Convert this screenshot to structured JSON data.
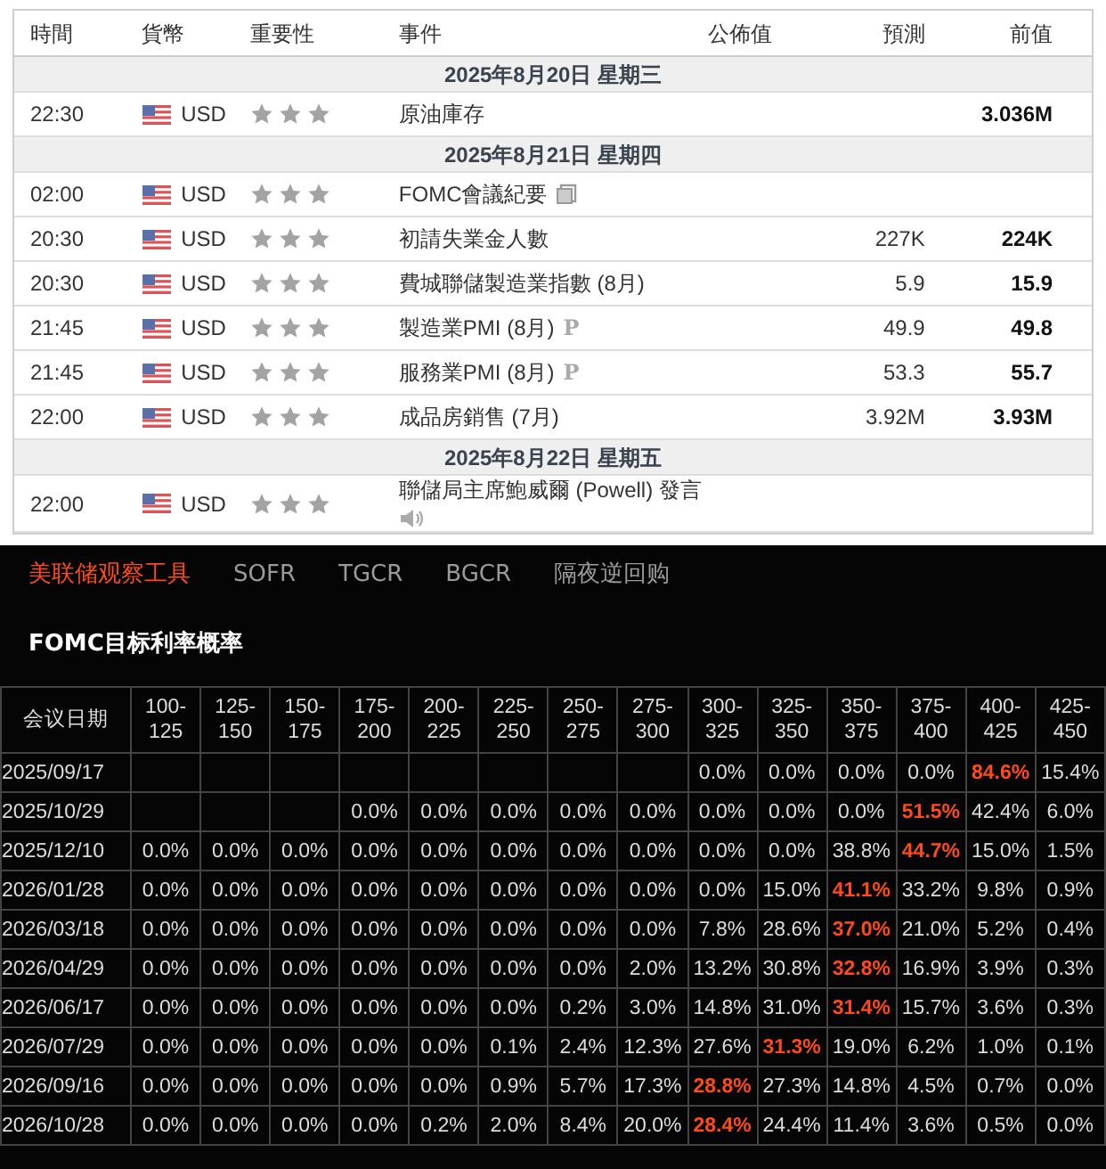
{
  "calendar": {
    "columns": [
      "時間",
      "貨幣",
      "重要性",
      "事件",
      "公佈值",
      "預測",
      "前值"
    ],
    "rows": [
      {
        "kind": "date",
        "label": "2025年8月20日  星期三"
      },
      {
        "kind": "event",
        "time": "22:30",
        "currency": "USD",
        "stars": 3,
        "event": "原油庫存",
        "previous": "3.036M"
      },
      {
        "kind": "date",
        "label": "2025年8月21日  星期四"
      },
      {
        "kind": "event",
        "time": "02:00",
        "currency": "USD",
        "stars": 3,
        "event": "FOMC會議紀要",
        "marker": {
          "kind": "document"
        }
      },
      {
        "kind": "event",
        "time": "20:30",
        "currency": "USD",
        "stars": 3,
        "event": "初請失業金人數",
        "forecast": "227K",
        "previous": "224K"
      },
      {
        "kind": "event",
        "time": "20:30",
        "currency": "USD",
        "stars": 3,
        "event": "費城聯儲製造業指數 (8月)",
        "forecast": "5.9",
        "previous": "15.9"
      },
      {
        "kind": "event",
        "time": "21:45",
        "currency": "USD",
        "stars": 3,
        "event": "製造業PMI (8月)",
        "badge": "P",
        "forecast": "49.9",
        "previous": "49.8"
      },
      {
        "kind": "event",
        "time": "21:45",
        "currency": "USD",
        "stars": 3,
        "event": "服務業PMI (8月)",
        "badge": "P",
        "forecast": "53.3",
        "previous": "55.7"
      },
      {
        "kind": "event",
        "time": "22:00",
        "currency": "USD",
        "stars": 3,
        "event": "成品房銷售 (7月)",
        "forecast": "3.92M",
        "previous": "3.93M"
      },
      {
        "kind": "date",
        "label": "2025年8月22日  星期五"
      },
      {
        "kind": "event",
        "time": "22:00",
        "currency": "USD",
        "stars": 3,
        "event": "聯儲局主席鮑威爾 (Powell) 發言",
        "marker": {
          "kind": "audio"
        }
      }
    ]
  },
  "tools": {
    "tabs": [
      {
        "label": "美联储观察工具",
        "selected": true
      },
      {
        "label": "SOFR",
        "selected": false
      },
      {
        "label": "TGCR",
        "selected": false
      },
      {
        "label": "BGCR",
        "selected": false
      },
      {
        "label": "隔夜逆回购",
        "selected": false
      }
    ],
    "title": "FOMC目标利率概率",
    "date_header": "会议日期",
    "columns": [
      "100-\n125",
      "125-\n150",
      "150-\n175",
      "175-\n200",
      "200-\n225",
      "225-\n250",
      "250-\n275",
      "275-\n300",
      "300-\n325",
      "325-\n350",
      "350-\n375",
      "375-\n400",
      "400-\n425",
      "425-\n450"
    ],
    "rows": [
      {
        "date": "2025/09/17",
        "cells": [
          null,
          null,
          null,
          null,
          null,
          null,
          null,
          null,
          {
            "value": "0.0%",
            "highlight": false
          },
          {
            "value": "0.0%",
            "highlight": false
          },
          {
            "value": "0.0%",
            "highlight": false
          },
          {
            "value": "0.0%",
            "highlight": false
          },
          {
            "value": "84.6%",
            "highlight": true
          },
          {
            "value": "15.4%",
            "highlight": false
          }
        ]
      },
      {
        "date": "2025/10/29",
        "cells": [
          null,
          null,
          null,
          {
            "value": "0.0%",
            "highlight": false
          },
          {
            "value": "0.0%",
            "highlight": false
          },
          {
            "value": "0.0%",
            "highlight": false
          },
          {
            "value": "0.0%",
            "highlight": false
          },
          {
            "value": "0.0%",
            "highlight": false
          },
          {
            "value": "0.0%",
            "highlight": false
          },
          {
            "value": "0.0%",
            "highlight": false
          },
          {
            "value": "0.0%",
            "highlight": false
          },
          {
            "value": "51.5%",
            "highlight": true
          },
          {
            "value": "42.4%",
            "highlight": false
          },
          {
            "value": "6.0%",
            "highlight": false
          }
        ]
      },
      {
        "date": "2025/12/10",
        "cells": [
          {
            "value": "0.0%",
            "highlight": false
          },
          {
            "value": "0.0%",
            "highlight": false
          },
          {
            "value": "0.0%",
            "highlight": false
          },
          {
            "value": "0.0%",
            "highlight": false
          },
          {
            "value": "0.0%",
            "highlight": false
          },
          {
            "value": "0.0%",
            "highlight": false
          },
          {
            "value": "0.0%",
            "highlight": false
          },
          {
            "value": "0.0%",
            "highlight": false
          },
          {
            "value": "0.0%",
            "highlight": false
          },
          {
            "value": "0.0%",
            "highlight": false
          },
          {
            "value": "38.8%",
            "highlight": false
          },
          {
            "value": "44.7%",
            "highlight": true
          },
          {
            "value": "15.0%",
            "highlight": false
          },
          {
            "value": "1.5%",
            "highlight": false
          }
        ]
      },
      {
        "date": "2026/01/28",
        "cells": [
          {
            "value": "0.0%",
            "highlight": false
          },
          {
            "value": "0.0%",
            "highlight": false
          },
          {
            "value": "0.0%",
            "highlight": false
          },
          {
            "value": "0.0%",
            "highlight": false
          },
          {
            "value": "0.0%",
            "highlight": false
          },
          {
            "value": "0.0%",
            "highlight": false
          },
          {
            "value": "0.0%",
            "highlight": false
          },
          {
            "value": "0.0%",
            "highlight": false
          },
          {
            "value": "0.0%",
            "highlight": false
          },
          {
            "value": "15.0%",
            "highlight": false
          },
          {
            "value": "41.1%",
            "highlight": true
          },
          {
            "value": "33.2%",
            "highlight": false
          },
          {
            "value": "9.8%",
            "highlight": false
          },
          {
            "value": "0.9%",
            "highlight": false
          }
        ]
      },
      {
        "date": "2026/03/18",
        "cells": [
          {
            "value": "0.0%",
            "highlight": false
          },
          {
            "value": "0.0%",
            "highlight": false
          },
          {
            "value": "0.0%",
            "highlight": false
          },
          {
            "value": "0.0%",
            "highlight": false
          },
          {
            "value": "0.0%",
            "highlight": false
          },
          {
            "value": "0.0%",
            "highlight": false
          },
          {
            "value": "0.0%",
            "highlight": false
          },
          {
            "value": "0.0%",
            "highlight": false
          },
          {
            "value": "7.8%",
            "highlight": false
          },
          {
            "value": "28.6%",
            "highlight": false
          },
          {
            "value": "37.0%",
            "highlight": true
          },
          {
            "value": "21.0%",
            "highlight": false
          },
          {
            "value": "5.2%",
            "highlight": false
          },
          {
            "value": "0.4%",
            "highlight": false
          }
        ]
      },
      {
        "date": "2026/04/29",
        "cells": [
          {
            "value": "0.0%",
            "highlight": false
          },
          {
            "value": "0.0%",
            "highlight": false
          },
          {
            "value": "0.0%",
            "highlight": false
          },
          {
            "value": "0.0%",
            "highlight": false
          },
          {
            "value": "0.0%",
            "highlight": false
          },
          {
            "value": "0.0%",
            "highlight": false
          },
          {
            "value": "0.0%",
            "highlight": false
          },
          {
            "value": "2.0%",
            "highlight": false
          },
          {
            "value": "13.2%",
            "highlight": false
          },
          {
            "value": "30.8%",
            "highlight": false
          },
          {
            "value": "32.8%",
            "highlight": true
          },
          {
            "value": "16.9%",
            "highlight": false
          },
          {
            "value": "3.9%",
            "highlight": false
          },
          {
            "value": "0.3%",
            "highlight": false
          }
        ]
      },
      {
        "date": "2026/06/17",
        "cells": [
          {
            "value": "0.0%",
            "highlight": false
          },
          {
            "value": "0.0%",
            "highlight": false
          },
          {
            "value": "0.0%",
            "highlight": false
          },
          {
            "value": "0.0%",
            "highlight": false
          },
          {
            "value": "0.0%",
            "highlight": false
          },
          {
            "value": "0.0%",
            "highlight": false
          },
          {
            "value": "0.2%",
            "highlight": false
          },
          {
            "value": "3.0%",
            "highlight": false
          },
          {
            "value": "14.8%",
            "highlight": false
          },
          {
            "value": "31.0%",
            "highlight": false
          },
          {
            "value": "31.4%",
            "highlight": true
          },
          {
            "value": "15.7%",
            "highlight": false
          },
          {
            "value": "3.6%",
            "highlight": false
          },
          {
            "value": "0.3%",
            "highlight": false
          }
        ]
      },
      {
        "date": "2026/07/29",
        "cells": [
          {
            "value": "0.0%",
            "highlight": false
          },
          {
            "value": "0.0%",
            "highlight": false
          },
          {
            "value": "0.0%",
            "highlight": false
          },
          {
            "value": "0.0%",
            "highlight": false
          },
          {
            "value": "0.0%",
            "highlight": false
          },
          {
            "value": "0.1%",
            "highlight": false
          },
          {
            "value": "2.4%",
            "highlight": false
          },
          {
            "value": "12.3%",
            "highlight": false
          },
          {
            "value": "27.6%",
            "highlight": false
          },
          {
            "value": "31.3%",
            "highlight": true
          },
          {
            "value": "19.0%",
            "highlight": false
          },
          {
            "value": "6.2%",
            "highlight": false
          },
          {
            "value": "1.0%",
            "highlight": false
          },
          {
            "value": "0.1%",
            "highlight": false
          }
        ]
      },
      {
        "date": "2026/09/16",
        "cells": [
          {
            "value": "0.0%",
            "highlight": false
          },
          {
            "value": "0.0%",
            "highlight": false
          },
          {
            "value": "0.0%",
            "highlight": false
          },
          {
            "value": "0.0%",
            "highlight": false
          },
          {
            "value": "0.0%",
            "highlight": false
          },
          {
            "value": "0.9%",
            "highlight": false
          },
          {
            "value": "5.7%",
            "highlight": false
          },
          {
            "value": "17.3%",
            "highlight": false
          },
          {
            "value": "28.8%",
            "highlight": true
          },
          {
            "value": "27.3%",
            "highlight": false
          },
          {
            "value": "14.8%",
            "highlight": false
          },
          {
            "value": "4.5%",
            "highlight": false
          },
          {
            "value": "0.7%",
            "highlight": false
          },
          {
            "value": "0.0%",
            "highlight": false
          }
        ]
      },
      {
        "date": "2026/10/28",
        "cells": [
          {
            "value": "0.0%",
            "highlight": false
          },
          {
            "value": "0.0%",
            "highlight": false
          },
          {
            "value": "0.0%",
            "highlight": false
          },
          {
            "value": "0.0%",
            "highlight": false
          },
          {
            "value": "0.2%",
            "highlight": false
          },
          {
            "value": "2.0%",
            "highlight": false
          },
          {
            "value": "8.4%",
            "highlight": false
          },
          {
            "value": "20.0%",
            "highlight": false
          },
          {
            "value": "28.4%",
            "highlight": true
          },
          {
            "value": "24.4%",
            "highlight": false
          },
          {
            "value": "11.4%",
            "highlight": false
          },
          {
            "value": "3.6%",
            "highlight": false
          },
          {
            "value": "0.5%",
            "highlight": false
          },
          {
            "value": "0.0%",
            "highlight": false
          }
        ]
      }
    ]
  }
}
